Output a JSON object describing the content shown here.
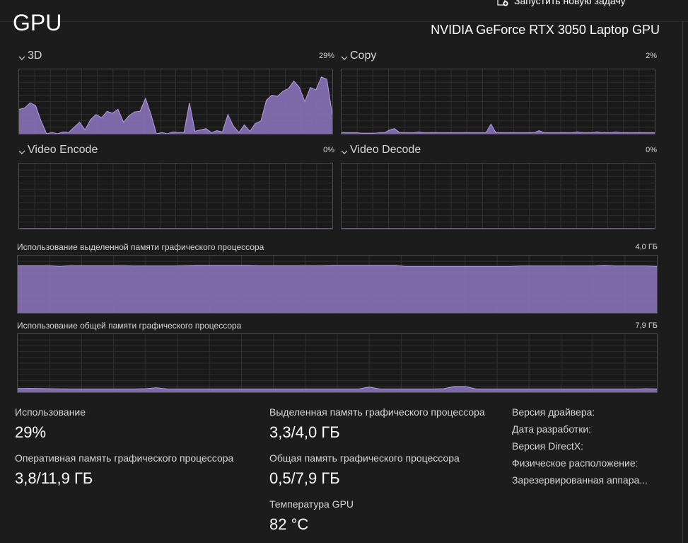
{
  "header": {
    "new_task_label": "Запустить новую задачу",
    "title": "GPU",
    "gpu_name": "NVIDIA GeForce RTX 3050 Laptop GPU"
  },
  "colors": {
    "graph_fill": "#8a72b8",
    "graph_line": "#b59ee0",
    "grid": "#2f2f2f"
  },
  "engines": [
    {
      "label": "3D",
      "percent": "29%"
    },
    {
      "label": "Copy",
      "percent": "2%"
    },
    {
      "label": "Video Encode",
      "percent": "0%"
    },
    {
      "label": "Video Decode",
      "percent": "0%"
    }
  ],
  "memory_graphs": {
    "dedicated": {
      "label": "Использование выделенной памяти графического процессора",
      "max": "4,0 ГБ"
    },
    "shared": {
      "label": "Использование общей памяти графического процессора",
      "max": "7,9 ГБ"
    }
  },
  "stats": {
    "utilization": {
      "label": "Использование",
      "value": "29%"
    },
    "gpu_ram": {
      "label": "Оперативная память графического процессора",
      "value": "3,8/11,9 ГБ"
    },
    "dedicated": {
      "label": "Выделенная память графического процессора",
      "value": "3,3/4,0 ГБ"
    },
    "shared": {
      "label": "Общая память графического процессора",
      "value": "0,5/7,9 ГБ"
    },
    "temperature": {
      "label": "Температура GPU",
      "value": "82 °C"
    }
  },
  "info": {
    "driver_version": "Версия драйвера:",
    "driver_date": "Дата разработки:",
    "directx": "Версия DirectX:",
    "location": "Физическое расположение:",
    "reserved": "Зарезервированная аппара..."
  },
  "chart_data": [
    {
      "type": "area",
      "series": [
        {
          "name": "3D",
          "values": [
            38,
            40,
            48,
            44,
            20,
            0,
            2,
            0,
            3,
            2,
            10,
            18,
            6,
            22,
            30,
            25,
            35,
            32,
            38,
            18,
            28,
            34,
            35,
            55,
            30,
            0,
            2,
            0,
            3,
            2,
            2,
            48,
            4,
            6,
            8,
            2,
            5,
            3,
            30,
            12,
            2,
            14,
            4,
            16,
            20,
            52,
            60,
            58,
            66,
            70,
            82,
            72,
            50,
            72,
            68,
            88,
            85,
            30
          ]
        }
      ],
      "ylim": [
        0,
        100
      ]
    },
    {
      "type": "area",
      "series": [
        {
          "name": "Copy",
          "values": [
            2,
            2,
            2,
            2,
            1,
            1,
            1,
            1,
            2,
            2,
            6,
            8,
            2,
            2,
            2,
            2,
            3,
            2,
            2,
            2,
            2,
            2,
            2,
            2,
            2,
            2,
            2,
            2,
            2,
            2,
            2,
            15,
            2,
            2,
            2,
            2,
            2,
            2,
            2,
            2,
            2,
            5,
            2,
            2,
            2,
            2,
            2,
            2,
            2,
            3,
            2,
            2,
            2,
            3,
            2,
            2,
            2,
            3,
            2,
            2,
            2,
            2,
            2,
            2,
            2,
            2
          ]
        }
      ],
      "ylim": [
        0,
        100
      ]
    },
    {
      "type": "area",
      "series": [
        {
          "name": "Video Encode",
          "values": [
            0,
            0,
            0,
            0,
            0,
            0,
            0,
            0,
            0,
            0
          ]
        }
      ],
      "ylim": [
        0,
        100
      ]
    },
    {
      "type": "area",
      "series": [
        {
          "name": "Video Decode",
          "values": [
            0,
            0,
            0,
            0,
            0,
            0,
            0,
            0,
            0,
            0
          ]
        }
      ],
      "ylim": [
        0,
        100
      ]
    },
    {
      "type": "area",
      "series": [
        {
          "values": [
            3.3,
            3.3,
            3.3,
            3.3,
            3.25,
            3.3,
            3.3,
            3.3,
            3.3,
            3.3,
            3.3,
            3.28,
            3.28,
            3.28,
            3.28,
            3.28,
            3.3,
            3.32,
            3.32,
            3.32,
            3.32,
            3.32,
            3.32,
            3.3,
            3.3,
            3.3,
            3.3,
            3.3,
            3.3,
            3.3,
            3.32,
            3.32,
            3.32,
            3.32,
            3.32,
            3.32,
            3.32,
            3.25,
            3.25,
            3.25,
            3.25,
            3.25,
            3.25,
            3.25,
            3.25,
            3.25,
            3.25,
            3.25,
            3.28,
            3.28,
            3.28,
            3.28,
            3.28,
            3.28,
            3.28,
            3.28,
            3.32,
            3.28,
            3.28,
            3.28,
            3.28,
            3.25
          ]
        }
      ],
      "ylim": [
        0,
        4.0
      ]
    },
    {
      "type": "area",
      "series": [
        {
          "values": [
            0.5,
            0.52,
            0.5,
            0.48,
            0.46,
            0.44,
            0.44,
            0.44,
            0.44,
            0.44,
            0.44,
            0.44,
            0.48,
            0.6,
            0.46,
            0.44,
            0.44,
            0.44,
            0.44,
            0.44,
            0.44,
            0.44,
            0.44,
            0.44,
            0.44,
            0.44,
            0.44,
            0.44,
            0.44,
            0.44,
            0.44,
            0.44,
            0.44,
            0.7,
            0.44,
            0.44,
            0.44,
            0.44,
            0.44,
            0.44,
            0.48,
            0.78,
            0.78,
            0.46,
            0.44,
            0.44,
            0.44,
            0.44,
            0.44,
            0.44,
            0.44,
            0.44,
            0.44,
            0.44,
            0.44,
            0.44,
            0.44,
            0.44,
            0.44,
            0.48,
            0.44
          ]
        }
      ],
      "ylim": [
        0,
        7.9
      ]
    }
  ]
}
